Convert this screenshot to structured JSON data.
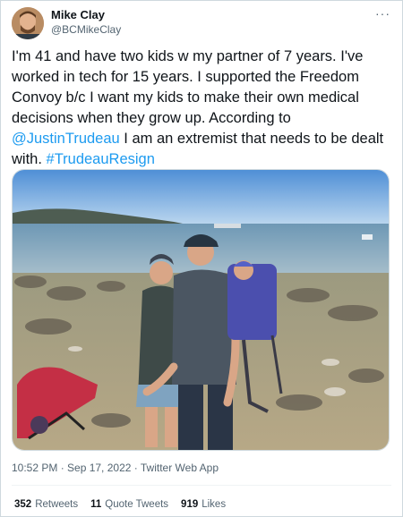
{
  "user": {
    "name": "Mike Clay",
    "handle": "@BCMikeClay"
  },
  "tweet": {
    "text_start": "I'm 41 and have two kids w my partner of 7 years. I've worked in tech for 15 years. I supported the Freedom Convoy b/c I want my kids to make their own medical decisions when they grow up. According to ",
    "mention": "@JustinTrudeau",
    "text_end": " I am an extremist that needs to be dealt with. ",
    "hashtag": "#TrudeauResign"
  },
  "meta": {
    "timestamp": "10:52 PM · Sep 17, 2022 · Twitter Web App"
  },
  "stats": {
    "retweets_count": "352",
    "retweets_label": "Retweets",
    "quotes_count": "11",
    "quotes_label": "Quote Tweets",
    "likes_count": "919",
    "likes_label": "Likes"
  },
  "colors": {
    "link": "#1d9bf0",
    "text": "#0f1419",
    "secondary": "#536471"
  }
}
